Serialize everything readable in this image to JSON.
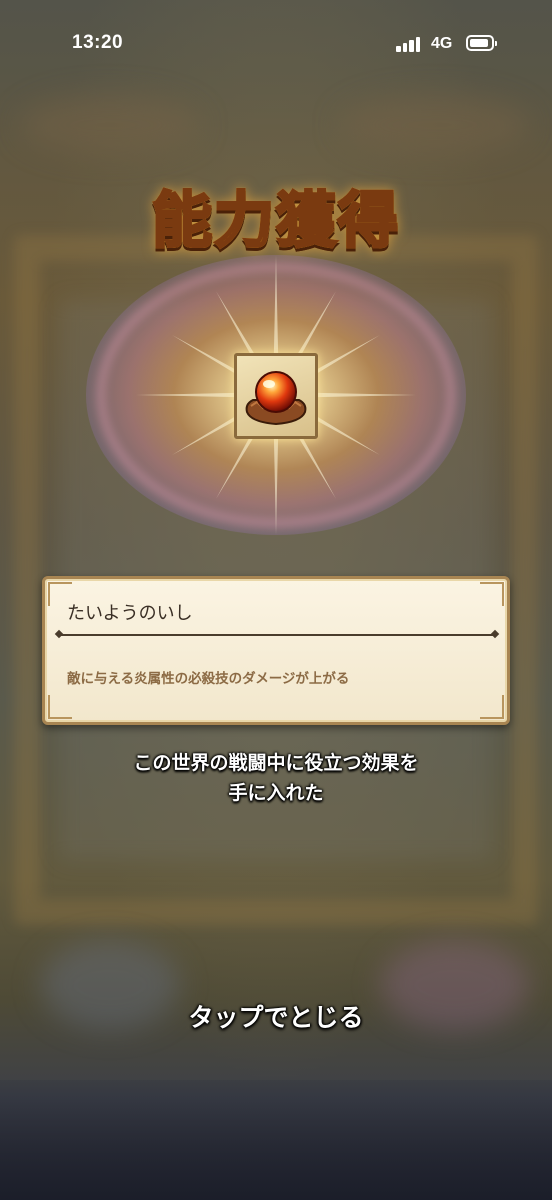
{
  "status_bar": {
    "time": "13:20",
    "network": "4G",
    "icons": [
      "signal-icon",
      "battery-icon"
    ]
  },
  "title": "能力獲得",
  "item": {
    "icon": "sun-stone-icon",
    "name": "たいようのいし",
    "description": "敵に与える炎属性の必殺技のダメージが上がる"
  },
  "message": {
    "line1": "この世界の戦闘中に役立つ効果を",
    "line2": "手に入れた"
  },
  "tap_to_close": "タップでとじる",
  "colors": {
    "title_fill": "#ffd03a",
    "title_outline": "#7a3a10",
    "panel_bg": "#fbf4e3",
    "panel_border": "#a88552",
    "desc_text": "#8c6b45"
  }
}
